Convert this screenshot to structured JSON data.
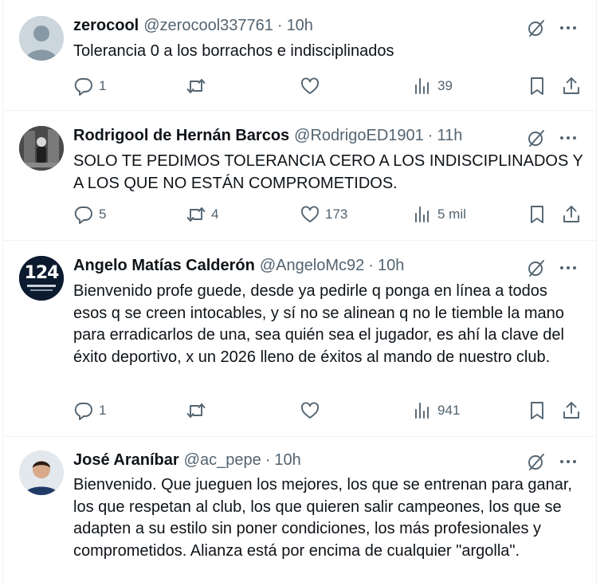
{
  "tweets": [
    {
      "name": "zerocool",
      "handle": "@zerocool337761",
      "time": "10h",
      "text": "Tolerancia 0  a los borrachos e indisciplinados",
      "replies": "1",
      "retweets": "",
      "likes": "",
      "views": "39",
      "avatar": "default-avatar"
    },
    {
      "name": "Rodrigool de Hernán Barcos",
      "handle": "@RodrigoED1901",
      "time": "11h",
      "text": "SOLO TE PEDIMOS TOLERANCIA CERO A LOS INDISCIPLINADOS Y A LOS QUE NO ESTÁN COMPROMETIDOS.",
      "replies": "5",
      "retweets": "4",
      "likes": "173",
      "views": "5 mil",
      "avatar": "photo-avatar"
    },
    {
      "name": "Angelo Matías Calderón",
      "handle": "@AngeloMc92",
      "time": "10h",
      "text": "Bienvenido profe guede, desde ya pedirle q ponga en línea a todos esos q se creen intocables, y sí no se alinean q no le tiemble la mano para erradicarlos de una, sea quién sea el jugador, es ahí la clave del éxito deportivo, x un 2026 lleno de éxitos al mando de nuestro club.",
      "replies": "1",
      "retweets": "",
      "likes": "",
      "views": "941",
      "avatar": "logo-avatar",
      "avatar_text": "124"
    },
    {
      "name": "José Araníbar",
      "handle": "@ac_pepe",
      "time": "10h",
      "text": "Bienvenido. Que jueguen los mejores, los que se entrenan para ganar, los que respetan al club, los que quieren salir campeones, los que se adapten a su estilo sin poner condiciones, los más profesionales y comprometidos. Alianza está por encima de cualquier \"argolla\".",
      "avatar": "photo-avatar"
    }
  ],
  "separator": "·",
  "colors": {
    "text": "#0f1419",
    "secondary": "#536471",
    "border": "#eff3f4"
  },
  "icons": [
    "grok-icon",
    "more-icon",
    "reply-icon",
    "retweet-icon",
    "like-icon",
    "views-icon",
    "bookmark-icon",
    "share-icon"
  ]
}
